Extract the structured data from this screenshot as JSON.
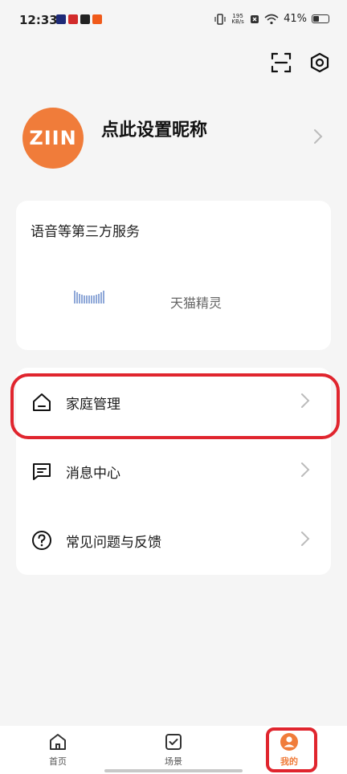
{
  "status_bar": {
    "time": "12:33",
    "net_speed_value": "195",
    "net_speed_unit": "KB/s",
    "battery": "41%"
  },
  "header": {
    "scan_icon": "scan-icon",
    "settings_icon": "settings-icon"
  },
  "profile": {
    "avatar_text": "ZIIN",
    "nickname": "点此设置昵称"
  },
  "voice_services": {
    "title": "语音等第三方服务",
    "items": [
      {
        "name": "天猫精灵",
        "icon": "tmall-genie-logo"
      }
    ]
  },
  "menu": {
    "items": [
      {
        "label": "家庭管理",
        "icon": "home-icon"
      },
      {
        "label": "消息中心",
        "icon": "message-icon"
      },
      {
        "label": "常见问题与反馈",
        "icon": "help-icon"
      }
    ]
  },
  "bottom_nav": {
    "items": [
      {
        "label": "首页",
        "icon": "home-icon",
        "active": false
      },
      {
        "label": "场景",
        "icon": "scene-checkbox-icon",
        "active": false
      },
      {
        "label": "我的",
        "icon": "profile-icon",
        "active": true
      }
    ]
  },
  "colors": {
    "accent": "#f07c3a",
    "highlight": "#e0252e",
    "background": "#f5f5f5"
  }
}
